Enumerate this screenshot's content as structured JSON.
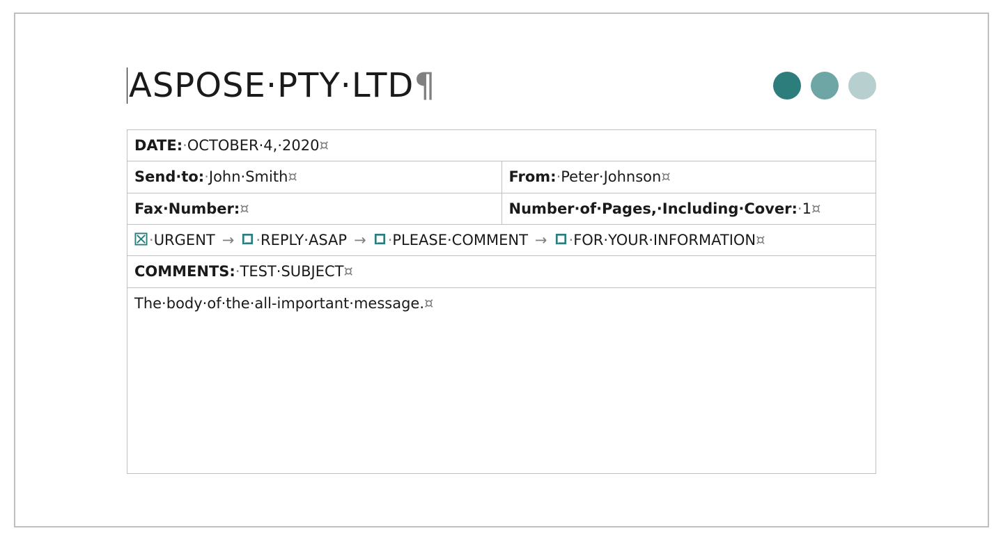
{
  "company_title": "ASPOSE·PTY·LTD",
  "logo_colors": [
    "#2e7d7d",
    "#6ea6a6",
    "#b7d0cf"
  ],
  "marks": {
    "pilcrow": "¶",
    "currency": "¤",
    "middot": "·",
    "arrow": "→"
  },
  "date": {
    "label": "DATE:",
    "value": "OCTOBER·4,·2020"
  },
  "send_to": {
    "label": "Send·to:",
    "value": "John·Smith"
  },
  "from": {
    "label": "From:",
    "value": "Peter·Johnson"
  },
  "fax_number": {
    "label": "Fax·Number:",
    "value": ""
  },
  "pages": {
    "label": "Number·of·Pages,·Including·Cover:",
    "value": "1"
  },
  "options": [
    {
      "label": "URGENT",
      "checked": true
    },
    {
      "label": "REPLY·ASAP",
      "checked": false
    },
    {
      "label": "PLEASE·COMMENT",
      "checked": false
    },
    {
      "label": "FOR·YOUR·INFORMATION",
      "checked": false
    }
  ],
  "comments": {
    "label": "COMMENTS:",
    "value": "TEST·SUBJECT"
  },
  "body": "The·body·of·the·all-important·message."
}
